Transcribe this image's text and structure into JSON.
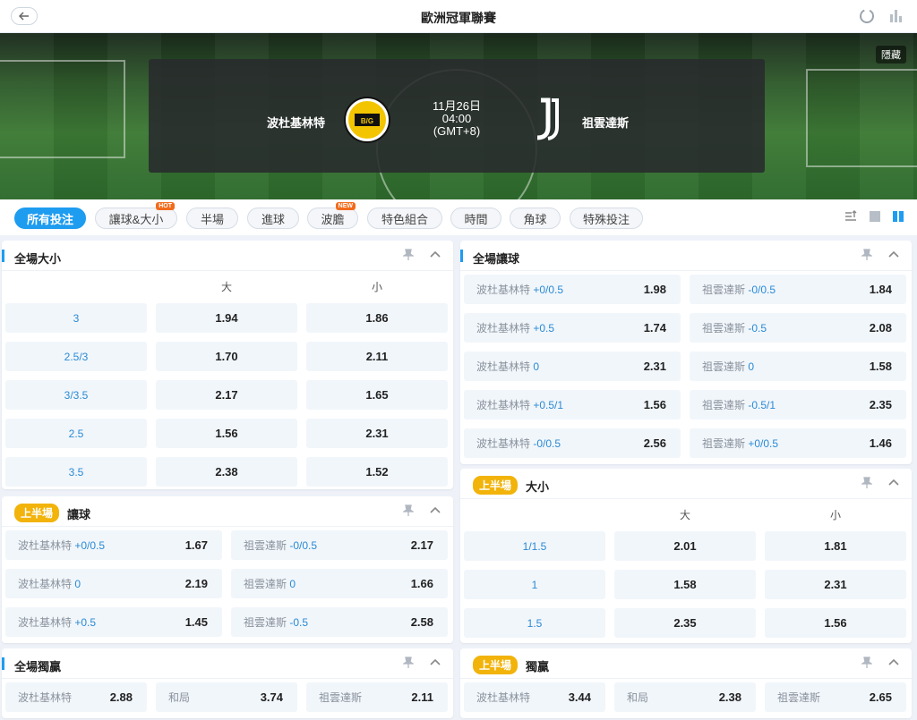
{
  "header": {
    "title": "歐洲冠軍聯賽",
    "back_icon": "arrow-left-icon",
    "refresh_icon": "refresh-icon",
    "stats_icon": "bar-chart-icon"
  },
  "match": {
    "hide_label": "隱藏",
    "home": "波杜基林特",
    "away": "祖雲達斯",
    "date": "11月26日",
    "time": "04:00",
    "tz": "(GMT+8)"
  },
  "tabs": [
    {
      "label": "所有投注",
      "active": true
    },
    {
      "label": "讓球&大小",
      "badge": "HOT"
    },
    {
      "label": "半場"
    },
    {
      "label": "進球"
    },
    {
      "label": "波膽",
      "badge": "NEW"
    },
    {
      "label": "特色組合"
    },
    {
      "label": "時間"
    },
    {
      "label": "角球"
    },
    {
      "label": "特殊投注"
    }
  ],
  "markets": {
    "ft_ou": {
      "title": "全場大小",
      "over": "大",
      "under": "小",
      "rows": [
        {
          "line": "3",
          "over": "1.94",
          "under": "1.86"
        },
        {
          "line": "2.5/3",
          "over": "1.70",
          "under": "2.11"
        },
        {
          "line": "3/3.5",
          "over": "2.17",
          "under": "1.65"
        },
        {
          "line": "2.5",
          "over": "1.56",
          "under": "2.31"
        },
        {
          "line": "3.5",
          "over": "2.38",
          "under": "1.52"
        }
      ]
    },
    "ft_hcp": {
      "title": "全場讓球",
      "rows": [
        {
          "home": "波杜基林特",
          "home_h": "+0/0.5",
          "home_odd": "1.98",
          "away": "祖雲達斯",
          "away_h": "-0/0.5",
          "away_odd": "1.84"
        },
        {
          "home": "波杜基林特",
          "home_h": "+0.5",
          "home_odd": "1.74",
          "away": "祖雲達斯",
          "away_h": "-0.5",
          "away_odd": "2.08"
        },
        {
          "home": "波杜基林特",
          "home_h": "0",
          "home_odd": "2.31",
          "away": "祖雲達斯",
          "away_h": "0",
          "away_odd": "1.58"
        },
        {
          "home": "波杜基林特",
          "home_h": "+0.5/1",
          "home_odd": "1.56",
          "away": "祖雲達斯",
          "away_h": "-0.5/1",
          "away_odd": "2.35"
        },
        {
          "home": "波杜基林特",
          "home_h": "-0/0.5",
          "home_odd": "2.56",
          "away": "祖雲達斯",
          "away_h": "+0/0.5",
          "away_odd": "1.46"
        }
      ]
    },
    "ht_hcp": {
      "badge": "上半場",
      "title": "讓球",
      "rows": [
        {
          "home": "波杜基林特",
          "home_h": "+0/0.5",
          "home_odd": "1.67",
          "away": "祖雲達斯",
          "away_h": "-0/0.5",
          "away_odd": "2.17"
        },
        {
          "home": "波杜基林特",
          "home_h": "0",
          "home_odd": "2.19",
          "away": "祖雲達斯",
          "away_h": "0",
          "away_odd": "1.66"
        },
        {
          "home": "波杜基林特",
          "home_h": "+0.5",
          "home_odd": "1.45",
          "away": "祖雲達斯",
          "away_h": "-0.5",
          "away_odd": "2.58"
        }
      ]
    },
    "ht_ou": {
      "badge": "上半場",
      "title": "大小",
      "over": "大",
      "under": "小",
      "rows": [
        {
          "line": "1/1.5",
          "over": "2.01",
          "under": "1.81"
        },
        {
          "line": "1",
          "over": "1.58",
          "under": "2.31"
        },
        {
          "line": "1.5",
          "over": "2.35",
          "under": "1.56"
        }
      ]
    },
    "ft_1x2": {
      "title": "全場獨贏",
      "home": "波杜基林特",
      "home_odd": "2.88",
      "draw": "和局",
      "draw_odd": "3.74",
      "away": "祖雲達斯",
      "away_odd": "2.11"
    },
    "ht_1x2": {
      "badge": "上半場",
      "title": "獨贏",
      "home": "波杜基林特",
      "home_odd": "3.44",
      "draw": "和局",
      "draw_odd": "2.38",
      "away": "祖雲達斯",
      "away_odd": "2.65"
    }
  },
  "colors": {
    "accent": "#1e9cf0",
    "half_badge": "#f2b30a",
    "hot": "#f26b1d"
  }
}
